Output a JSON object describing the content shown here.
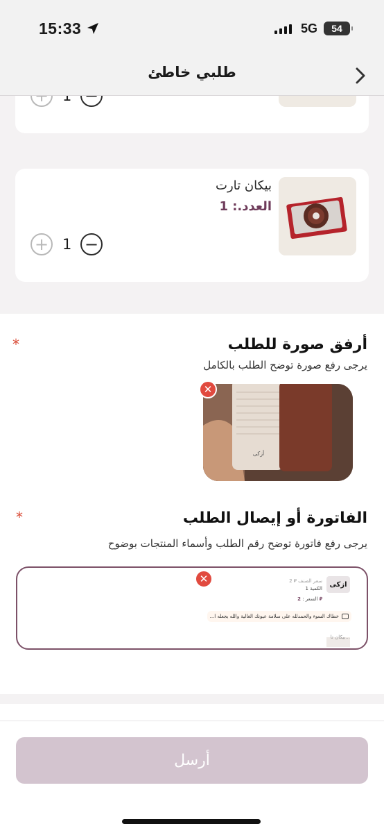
{
  "status_bar": {
    "time": "15:33",
    "network": "5G",
    "battery": "54"
  },
  "header": {
    "title": "طلبي خاطئ"
  },
  "items": [
    {
      "quantity": "1"
    },
    {
      "name": "بيكان تارت",
      "count_label": "العدد.: 1",
      "quantity": "1"
    }
  ],
  "photo_section": {
    "title": "أرفق صورة للطلب",
    "subtitle": "يرجى رفع صورة توضح الطلب بالكامل",
    "required_mark": "*",
    "photo_caption": "أزكى"
  },
  "invoice_section": {
    "title": "الفاتورة أو إيصال الطلب",
    "subtitle": "يرجى رفع فاتورة توضح رقم الطلب وأسماء المنتجات بوضوح",
    "required_mark": "*",
    "receipt": {
      "brand": "ازكى",
      "price_line": "2 ⃁ سعر الصنف",
      "count_line": "الكمية 1",
      "price_label": "السعر :",
      "price_value": "2 ⃁",
      "note": "خطاك السوء والحمدلله على سلامة عيونك الغالية والله يجعله ا...",
      "bottom_text": "بيكان تا..."
    }
  },
  "footer": {
    "send_label": "أرسل"
  },
  "colors": {
    "accent": "#6e3b5a",
    "send_disabled": "#d3c4cf",
    "required": "#d94a35",
    "remove": "#e14a3f"
  }
}
